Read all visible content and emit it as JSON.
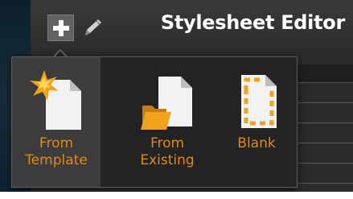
{
  "header": {
    "title": "Stylesheet Editor",
    "add_icon": "plus-icon",
    "edit_icon": "pencil-icon"
  },
  "menu": {
    "items": [
      {
        "label_line1": "From",
        "label_line2": "Template",
        "icon": "starburst-document-icon",
        "selected": true
      },
      {
        "label_line1": "From",
        "label_line2": "Existing",
        "icon": "folder-document-icon",
        "selected": false
      },
      {
        "label_line1": "Blank",
        "label_line2": "",
        "icon": "blank-document-icon",
        "selected": false
      }
    ]
  },
  "colors": {
    "accent": "#e08a16",
    "background": "#232323",
    "title_text": "#ffffff"
  }
}
